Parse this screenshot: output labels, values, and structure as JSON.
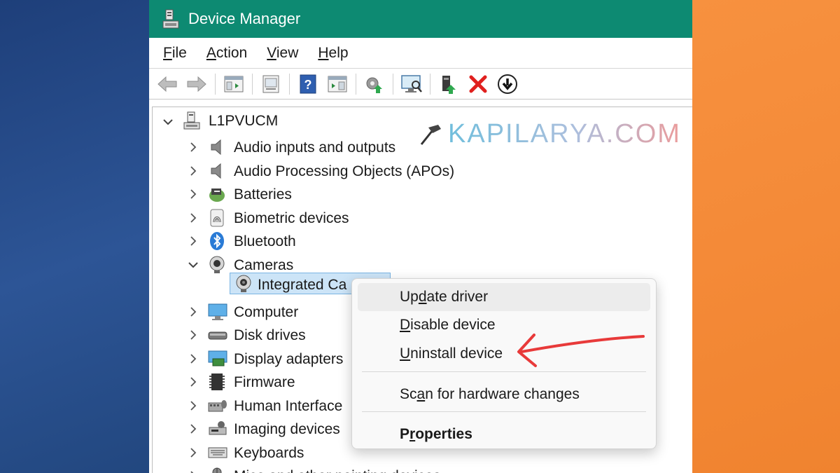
{
  "window": {
    "title": "Device Manager"
  },
  "menubar": [
    {
      "label": "File",
      "access_key": "F",
      "rest": "ile"
    },
    {
      "label": "Action",
      "access_key": "A",
      "rest": "ction"
    },
    {
      "label": "View",
      "access_key": "V",
      "rest": "iew"
    },
    {
      "label": "Help",
      "access_key": "H",
      "rest": "elp"
    }
  ],
  "toolbar": {
    "buttons": [
      "back-icon",
      "forward-icon",
      "show-hide-console-tree-icon",
      "properties-icon",
      "help-icon",
      "action-pane-icon",
      "update-driver-icon",
      "scan-hardware-icon",
      "enable-device-icon",
      "uninstall-icon",
      "disable-device-icon"
    ]
  },
  "tree": {
    "root": "L1PVUCM",
    "items": [
      {
        "label": "Audio inputs and outputs",
        "icon": "speaker-icon",
        "expanded": false
      },
      {
        "label": "Audio Processing Objects (APOs)",
        "icon": "speaker-icon",
        "expanded": false
      },
      {
        "label": "Batteries",
        "icon": "battery-icon",
        "expanded": false
      },
      {
        "label": "Biometric devices",
        "icon": "fingerprint-icon",
        "expanded": false
      },
      {
        "label": "Bluetooth",
        "icon": "bluetooth-icon",
        "expanded": false
      },
      {
        "label": "Cameras",
        "icon": "webcam-icon",
        "expanded": true
      },
      {
        "label": "Computer",
        "icon": "monitor-icon",
        "expanded": false
      },
      {
        "label": "Disk drives",
        "icon": "disk-drive-icon",
        "expanded": false
      },
      {
        "label": "Display adapters",
        "icon": "display-adapter-icon",
        "expanded": false
      },
      {
        "label": "Firmware",
        "icon": "firmware-chip-icon",
        "expanded": false
      },
      {
        "label": "Human Interface",
        "icon": "hid-icon",
        "expanded": false
      },
      {
        "label": "Imaging devices",
        "icon": "scanner-icon",
        "expanded": false
      },
      {
        "label": "Keyboards",
        "icon": "keyboard-icon",
        "expanded": false
      },
      {
        "label": "Mice and other pointing devices",
        "icon": "mouse-icon",
        "expanded": false
      }
    ],
    "selected_child": "Integrated Ca"
  },
  "watermark": {
    "text": "KAPILARYA.COM"
  },
  "context_menu": {
    "items": [
      {
        "label": "Update driver",
        "pre": "Up",
        "key": "d",
        "post": "ate driver"
      },
      {
        "label": "Disable device",
        "pre": "",
        "key": "D",
        "post": "isable device"
      },
      {
        "label": "Uninstall device",
        "pre": "",
        "key": "U",
        "post": "ninstall device"
      },
      {
        "label": "Scan for hardware changes",
        "pre": "Sc",
        "key": "a",
        "post": "n for hardware changes"
      },
      {
        "label": "Properties",
        "pre": "P",
        "key": "r",
        "post": "operties"
      }
    ]
  },
  "colors": {
    "titlebar": "#0d8a72",
    "annotation_arrow": "#e83a3a",
    "selection": "#cce4f7"
  }
}
